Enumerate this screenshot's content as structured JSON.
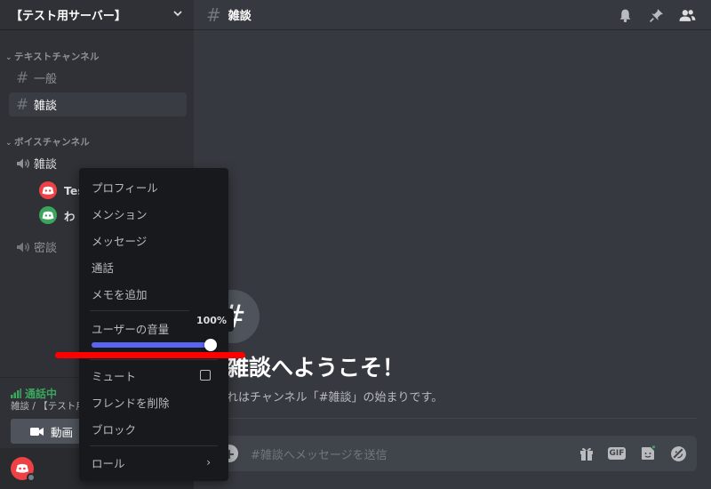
{
  "server": {
    "name": "【テスト用サーバー】"
  },
  "sidebar": {
    "categories": [
      {
        "label": "テキストチャンネル"
      },
      {
        "label": "ボイスチャンネル"
      }
    ],
    "text_channels": [
      {
        "name": "一般",
        "selected": false
      },
      {
        "name": "雑談",
        "selected": true
      }
    ],
    "voice_channels": [
      {
        "name": "雑談"
      },
      {
        "name": "密談"
      }
    ],
    "voice_users": [
      {
        "name": "Tes",
        "avatar_color": "#ed4245"
      },
      {
        "name": "わ",
        "avatar_color": "#3ba55d"
      }
    ]
  },
  "voice_panel": {
    "status": "通話中",
    "location": "雑談 / 【テスト用",
    "video_button": "動画"
  },
  "channel": {
    "title": "雑談"
  },
  "welcome": {
    "title": "雑談へようこそ！",
    "subtitle": "れはチャンネル「#雑談」の始まりです。"
  },
  "composer": {
    "placeholder": "#雑談へメッセージを送信",
    "gif_label": "GIF"
  },
  "context_menu": {
    "items": [
      {
        "label": "プロフィール"
      },
      {
        "label": "メンション"
      },
      {
        "label": "メッセージ"
      },
      {
        "label": "通話"
      },
      {
        "label": "メモを追加"
      }
    ],
    "volume_label": "ユーザーの音量",
    "volume_value": "100%",
    "volume_fraction": 1.0,
    "items_after": [
      {
        "label": "ミュート"
      },
      {
        "label": "フレンドを削除"
      },
      {
        "label": "ブロック"
      }
    ],
    "role_label": "ロール"
  },
  "colors": {
    "accent": "#5865f2",
    "online": "#3ba55d",
    "danger": "#ed4245",
    "annotation": "#ff0000"
  }
}
